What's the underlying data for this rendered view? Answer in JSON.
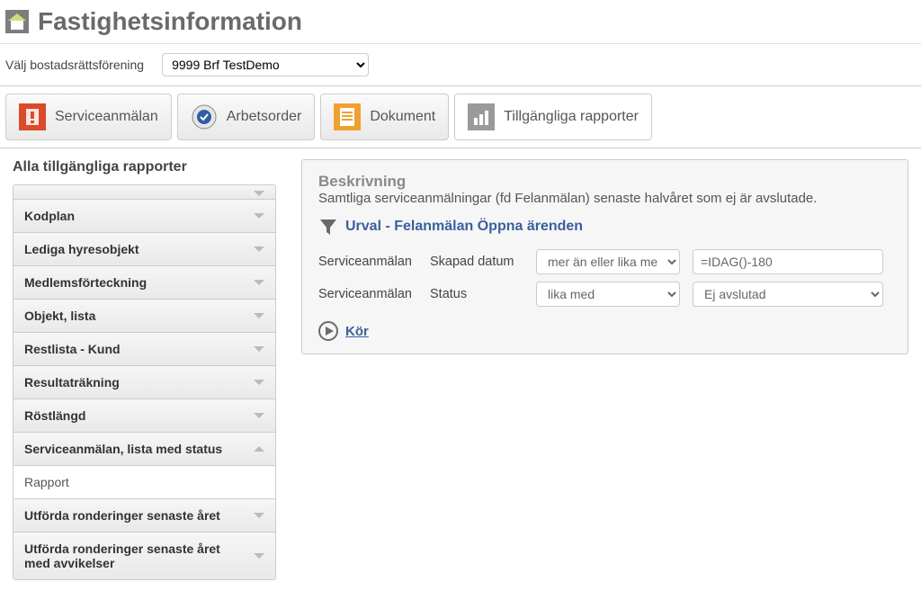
{
  "header": {
    "title": "Fastighetsinformation"
  },
  "selector": {
    "label": "Välj bostadsrättsförening",
    "value": "9999 Brf TestDemo"
  },
  "tabs": [
    {
      "label": "Serviceanmälan",
      "active": false
    },
    {
      "label": "Arbetsorder",
      "active": false
    },
    {
      "label": "Dokument",
      "active": false
    },
    {
      "label": "Tillgängliga rapporter",
      "active": true
    }
  ],
  "section_title": "Alla tillgängliga rapporter",
  "sidebar": {
    "items": [
      {
        "label": "Kodplan",
        "expanded": false
      },
      {
        "label": "Lediga hyresobjekt",
        "expanded": false
      },
      {
        "label": "Medlemsförteckning",
        "expanded": false
      },
      {
        "label": "Objekt, lista",
        "expanded": false
      },
      {
        "label": "Restlista - Kund",
        "expanded": false
      },
      {
        "label": "Resultaträkning",
        "expanded": false
      },
      {
        "label": "Röstlängd",
        "expanded": false
      },
      {
        "label": "Serviceanmälan, lista med status",
        "expanded": true
      },
      {
        "label": "Utförda ronderinger senaste året",
        "expanded": false
      },
      {
        "label": "Utförda ronderinger senaste året med avvikelser",
        "expanded": false
      }
    ],
    "sub_label": "Rapport"
  },
  "panel": {
    "desc_label": "Beskrivning",
    "desc_text": "Samtliga serviceanmälningar (fd Felanmälan) senaste halvåret som ej är avslutade.",
    "urval_title": "Urval - Felanmälan Öppna ärenden",
    "filters": [
      {
        "entity": "Serviceanmälan",
        "field": "Skapad datum",
        "op": "mer än eller lika med",
        "value": "=IDAG()-180",
        "val_type": "text"
      },
      {
        "entity": "Serviceanmälan",
        "field": "Status",
        "op": "lika med",
        "value": "Ej avslutad",
        "val_type": "select"
      }
    ],
    "run_label": "Kör"
  }
}
